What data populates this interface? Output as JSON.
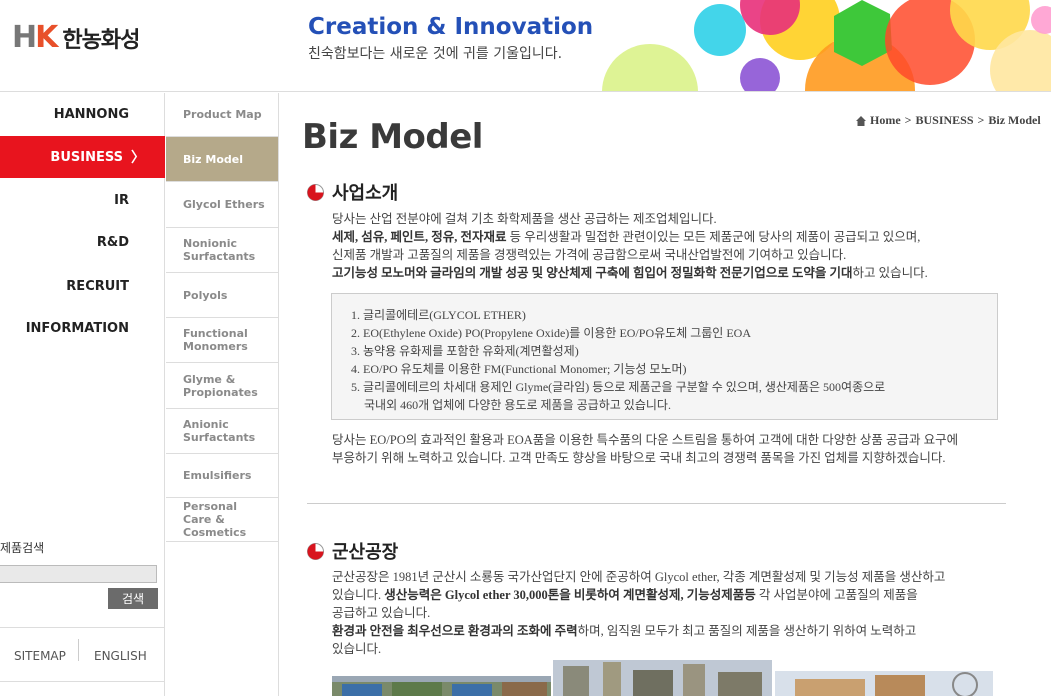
{
  "header": {
    "logo_mark": "HK",
    "logo_text": "한농화성",
    "slogan_title": "Creation & Innovation",
    "slogan_sub": "친숙함보다는 새로운 것에 귀를 기울입니다."
  },
  "mainnav": [
    {
      "label": "HANNONG"
    },
    {
      "label": "BUSINESS",
      "active": true
    },
    {
      "label": "IR"
    },
    {
      "label": "R&D"
    },
    {
      "label": "RECRUIT"
    },
    {
      "label": "INFORMATION"
    }
  ],
  "product_search": {
    "label": "제품검색",
    "placeholder": "",
    "button": "검색"
  },
  "utility": {
    "sitemap": "SITEMAP",
    "english": "ENGLISH"
  },
  "subnav": [
    {
      "label": "Product Map"
    },
    {
      "label": "Biz Model",
      "active": true
    },
    {
      "label": "Glycol Ethers"
    },
    {
      "label": "Nonionic Surfactants"
    },
    {
      "label": "Polyols"
    },
    {
      "label": "Functional Monomers"
    },
    {
      "label": "Glyme & Propionates"
    },
    {
      "label": "Anionic Surfactants"
    },
    {
      "label": "Emulsifiers"
    },
    {
      "label": "Personal Care & Cosmetics"
    }
  ],
  "breadcrumb": {
    "home": "Home",
    "sep": ">",
    "level1": "BUSINESS",
    "level2": "Biz Model"
  },
  "page_title": "Biz Model",
  "section1": {
    "title": "사업소개",
    "p1_line1": "당사는 산업 전분야에 걸쳐 기초 화학제품을 생산 공급하는 제조업체입니다.",
    "p1_line2_bold": "세제, 섬유, 페인트, 정유, 전자재료",
    "p1_line2_rest": " 등 우리생활과 밀접한 관련이있는 모든 제품군에 당사의 제품이 공급되고 있으며,",
    "p1_line3": "신제품 개발과 고품질의 제품을 경쟁력있는 가격에 공급함으로써 국내산업발전에 기여하고 있습니다.",
    "p1_line4_bold": "고기능성 모노머와 글라임의 개발 성공 및 양산체제 구축에 힘입어 정밀화학 전문기업으로 도약을 기대",
    "p1_line4_rest": "하고 있습니다.",
    "list": [
      "1. 글리콜에테르(GLYCOL ETHER)",
      "2. EO(Ethylene Oxide) PO(Propylene Oxide)를 이용한 EO/PO유도체 그룹인 EOA",
      "3. 농약용 유화제를 포함한 유화제(계면활성제)",
      "4. EO/PO 유도체를 이용한 FM(Functional Monomer; 기능성 모노머)",
      "5. 글리콜에테르의 차세대 용제인 Glyme(글라임) 등으로 제품군을 구분할 수 있으며, 생산제품은 500여종으로",
      "    국내외 460개 업체에 다양한 용도로 제품을 공급하고 있습니다."
    ],
    "p2_line1": "당사는 EO/PO의 효과적인 활용과 EOA품을 이용한 특수품의 다운 스트림을 통하여 고객에 대한 다양한 상품 공급과 요구에",
    "p2_line2": "부응하기 위해 노력하고 있습니다. 고객 만족도 향상을 바탕으로 국내 최고의 경쟁력 품목을 가진 업체를 지향하겠습니다."
  },
  "section2": {
    "title": "군산공장",
    "line1": "군산공장은 1981년 군산시 소룡동 국가산업단지 안에 준공하여 Glycol ether, 각종 계면활성제 및 기능성 제품을 생산하고",
    "line2_a": "있습니다. ",
    "line2_bold": "생산능력은 Glycol ether 30,000톤을 비롯하여 계면활성제, 기능성제품등",
    "line2_rest": " 각 사업분야에 고품질의 제품을",
    "line3": "공급하고 있습니다.",
    "line4_bold": "환경과 안전을 최우선으로 환경과의 조화에 주력",
    "line4_rest": "하며, 임직원 모두가 최고 품질의 제품을 생산하기 위하여 노력하고",
    "line5": "있습니다."
  },
  "colors": {
    "accent_red": "#e8141e",
    "subnav_active": "#b5a98a",
    "slogan_blue": "#2450b7"
  }
}
